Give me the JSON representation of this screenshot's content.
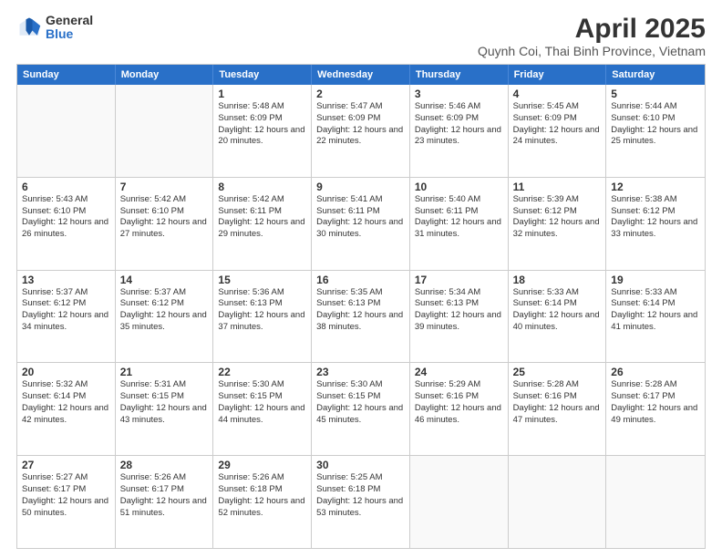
{
  "logo": {
    "general": "General",
    "blue": "Blue"
  },
  "title": "April 2025",
  "subtitle": "Quynh Coi, Thai Binh Province, Vietnam",
  "headers": [
    "Sunday",
    "Monday",
    "Tuesday",
    "Wednesday",
    "Thursday",
    "Friday",
    "Saturday"
  ],
  "weeks": [
    [
      {
        "day": "",
        "text": ""
      },
      {
        "day": "",
        "text": ""
      },
      {
        "day": "1",
        "text": "Sunrise: 5:48 AM\nSunset: 6:09 PM\nDaylight: 12 hours and 20 minutes."
      },
      {
        "day": "2",
        "text": "Sunrise: 5:47 AM\nSunset: 6:09 PM\nDaylight: 12 hours and 22 minutes."
      },
      {
        "day": "3",
        "text": "Sunrise: 5:46 AM\nSunset: 6:09 PM\nDaylight: 12 hours and 23 minutes."
      },
      {
        "day": "4",
        "text": "Sunrise: 5:45 AM\nSunset: 6:09 PM\nDaylight: 12 hours and 24 minutes."
      },
      {
        "day": "5",
        "text": "Sunrise: 5:44 AM\nSunset: 6:10 PM\nDaylight: 12 hours and 25 minutes."
      }
    ],
    [
      {
        "day": "6",
        "text": "Sunrise: 5:43 AM\nSunset: 6:10 PM\nDaylight: 12 hours and 26 minutes."
      },
      {
        "day": "7",
        "text": "Sunrise: 5:42 AM\nSunset: 6:10 PM\nDaylight: 12 hours and 27 minutes."
      },
      {
        "day": "8",
        "text": "Sunrise: 5:42 AM\nSunset: 6:11 PM\nDaylight: 12 hours and 29 minutes."
      },
      {
        "day": "9",
        "text": "Sunrise: 5:41 AM\nSunset: 6:11 PM\nDaylight: 12 hours and 30 minutes."
      },
      {
        "day": "10",
        "text": "Sunrise: 5:40 AM\nSunset: 6:11 PM\nDaylight: 12 hours and 31 minutes."
      },
      {
        "day": "11",
        "text": "Sunrise: 5:39 AM\nSunset: 6:12 PM\nDaylight: 12 hours and 32 minutes."
      },
      {
        "day": "12",
        "text": "Sunrise: 5:38 AM\nSunset: 6:12 PM\nDaylight: 12 hours and 33 minutes."
      }
    ],
    [
      {
        "day": "13",
        "text": "Sunrise: 5:37 AM\nSunset: 6:12 PM\nDaylight: 12 hours and 34 minutes."
      },
      {
        "day": "14",
        "text": "Sunrise: 5:37 AM\nSunset: 6:12 PM\nDaylight: 12 hours and 35 minutes."
      },
      {
        "day": "15",
        "text": "Sunrise: 5:36 AM\nSunset: 6:13 PM\nDaylight: 12 hours and 37 minutes."
      },
      {
        "day": "16",
        "text": "Sunrise: 5:35 AM\nSunset: 6:13 PM\nDaylight: 12 hours and 38 minutes."
      },
      {
        "day": "17",
        "text": "Sunrise: 5:34 AM\nSunset: 6:13 PM\nDaylight: 12 hours and 39 minutes."
      },
      {
        "day": "18",
        "text": "Sunrise: 5:33 AM\nSunset: 6:14 PM\nDaylight: 12 hours and 40 minutes."
      },
      {
        "day": "19",
        "text": "Sunrise: 5:33 AM\nSunset: 6:14 PM\nDaylight: 12 hours and 41 minutes."
      }
    ],
    [
      {
        "day": "20",
        "text": "Sunrise: 5:32 AM\nSunset: 6:14 PM\nDaylight: 12 hours and 42 minutes."
      },
      {
        "day": "21",
        "text": "Sunrise: 5:31 AM\nSunset: 6:15 PM\nDaylight: 12 hours and 43 minutes."
      },
      {
        "day": "22",
        "text": "Sunrise: 5:30 AM\nSunset: 6:15 PM\nDaylight: 12 hours and 44 minutes."
      },
      {
        "day": "23",
        "text": "Sunrise: 5:30 AM\nSunset: 6:15 PM\nDaylight: 12 hours and 45 minutes."
      },
      {
        "day": "24",
        "text": "Sunrise: 5:29 AM\nSunset: 6:16 PM\nDaylight: 12 hours and 46 minutes."
      },
      {
        "day": "25",
        "text": "Sunrise: 5:28 AM\nSunset: 6:16 PM\nDaylight: 12 hours and 47 minutes."
      },
      {
        "day": "26",
        "text": "Sunrise: 5:28 AM\nSunset: 6:17 PM\nDaylight: 12 hours and 49 minutes."
      }
    ],
    [
      {
        "day": "27",
        "text": "Sunrise: 5:27 AM\nSunset: 6:17 PM\nDaylight: 12 hours and 50 minutes."
      },
      {
        "day": "28",
        "text": "Sunrise: 5:26 AM\nSunset: 6:17 PM\nDaylight: 12 hours and 51 minutes."
      },
      {
        "day": "29",
        "text": "Sunrise: 5:26 AM\nSunset: 6:18 PM\nDaylight: 12 hours and 52 minutes."
      },
      {
        "day": "30",
        "text": "Sunrise: 5:25 AM\nSunset: 6:18 PM\nDaylight: 12 hours and 53 minutes."
      },
      {
        "day": "",
        "text": ""
      },
      {
        "day": "",
        "text": ""
      },
      {
        "day": "",
        "text": ""
      }
    ]
  ]
}
